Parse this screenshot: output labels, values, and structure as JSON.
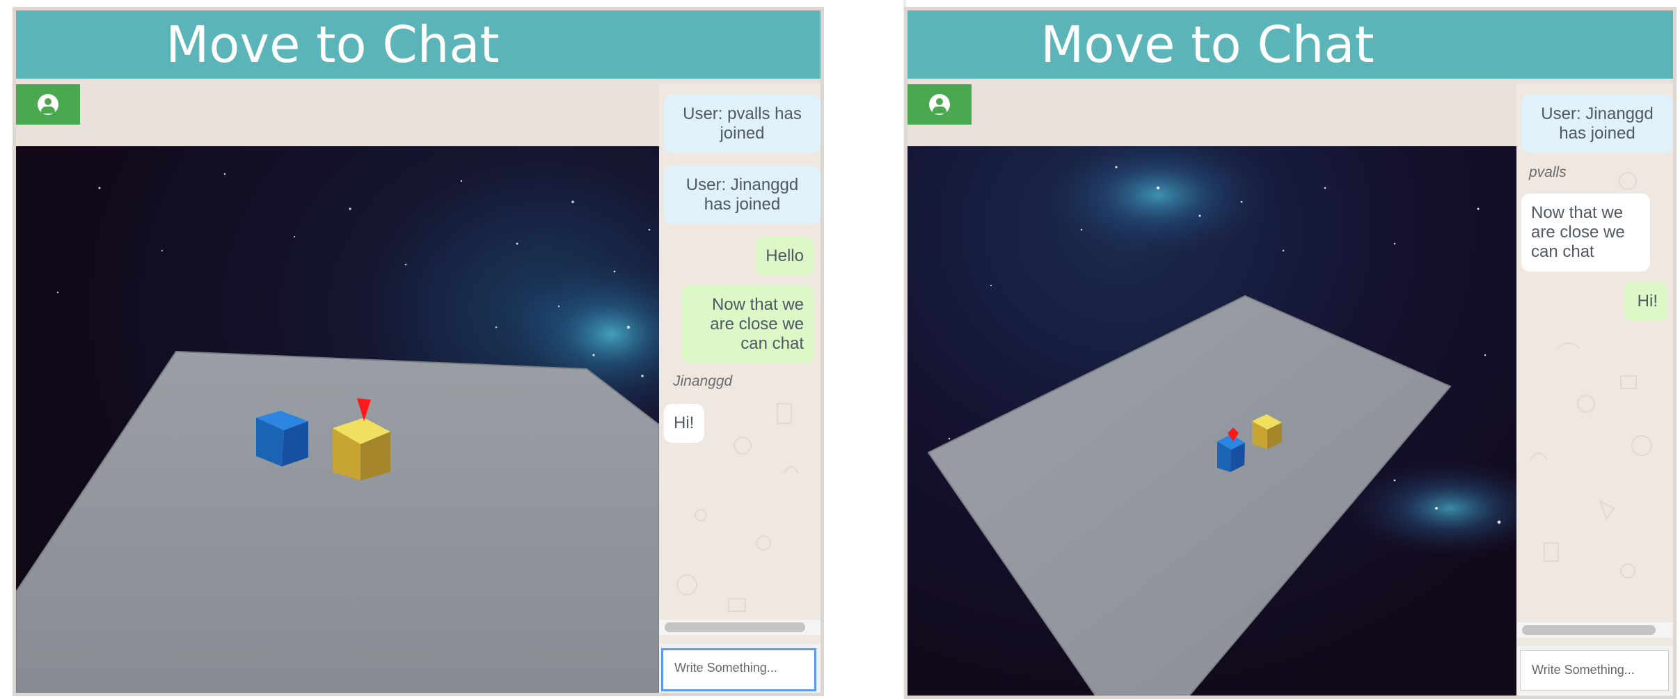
{
  "left": {
    "title": "Move to Chat",
    "messages": [
      {
        "kind": "sys",
        "text": "User: pvalls has joined"
      },
      {
        "kind": "sys",
        "text": "User: Jinanggd has joined"
      },
      {
        "kind": "out",
        "text": "Hello"
      },
      {
        "kind": "out",
        "text": "Now that we are close we can chat"
      },
      {
        "kind": "name",
        "text": "Jinanggd"
      },
      {
        "kind": "in",
        "text": "Hi!"
      }
    ],
    "input": {
      "placeholder": "Write Something..."
    }
  },
  "right": {
    "title": "Move to Chat",
    "messages": [
      {
        "kind": "sys",
        "text": "User: Jinanggd has joined"
      },
      {
        "kind": "name",
        "text": "pvalls"
      },
      {
        "kind": "in",
        "text": "Now that we are close we can chat"
      },
      {
        "kind": "out",
        "text": "Hi!"
      }
    ],
    "input": {
      "placeholder": "Write Something..."
    }
  },
  "icons": {
    "user_button": "user-circle-icon"
  },
  "colors": {
    "titlebar": "#5bb5b8",
    "user_button": "#4aa84e",
    "system_bubble": "#dff1fb",
    "outgoing_bubble": "#dcf8c6",
    "incoming_bubble": "#ffffff",
    "floor": "#8e939a",
    "blue_cube": "#1f6fc8",
    "yellow_cube": "#e3c63a",
    "marker": "#ff1a1a"
  }
}
